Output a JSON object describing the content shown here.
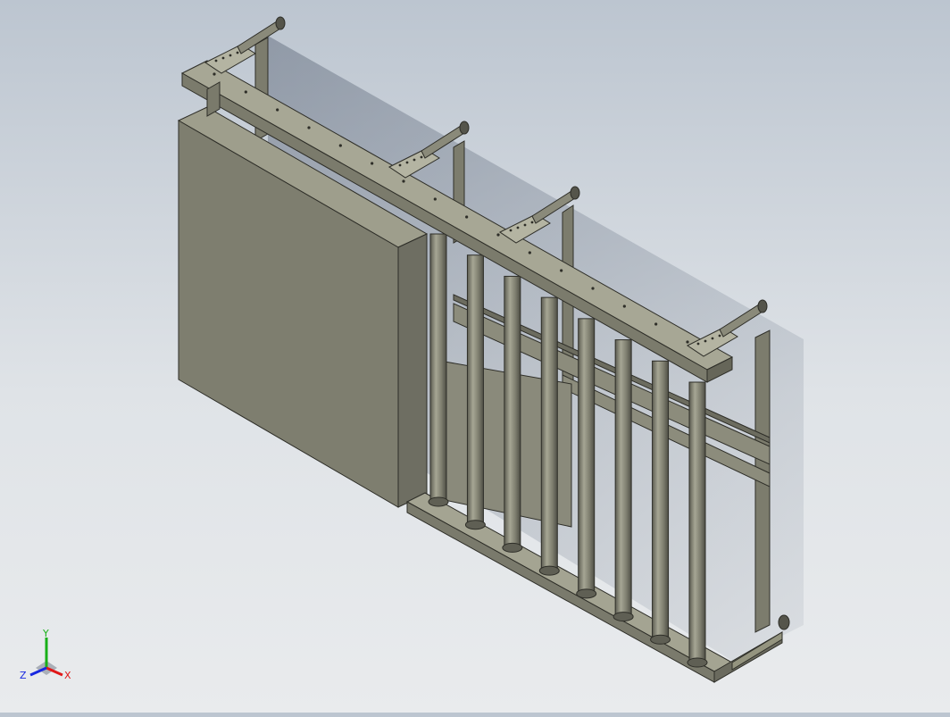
{
  "viewport": {
    "background_top": "#bcc5d0",
    "background_bottom": "#e9ebed",
    "model_color": "#8e8e7e",
    "model_shadow": "#6f6f62",
    "model_light": "#a8a896",
    "edge_color": "#2e2e28"
  },
  "triad": {
    "x_label": "X",
    "y_label": "Y",
    "z_label": "Z",
    "x_color": "#e01818",
    "y_color": "#18b018",
    "z_color": "#1828e0"
  },
  "model": {
    "description_icon": "cad-rack-assembly",
    "roller_count": 8,
    "corner_bracket_count": 4
  }
}
